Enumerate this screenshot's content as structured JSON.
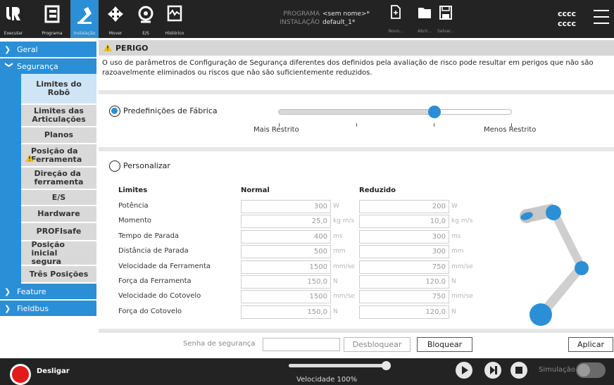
{
  "topbar": {
    "tabs": [
      {
        "label": "Executar",
        "icon": "ur-logo-icon"
      },
      {
        "label": "Programa",
        "icon": "program-icon"
      },
      {
        "label": "Instalação",
        "icon": "installation-icon"
      },
      {
        "label": "Mover",
        "icon": "move-icon"
      },
      {
        "label": "E/S",
        "icon": "io-icon"
      },
      {
        "label": "Histórico",
        "icon": "log-icon"
      }
    ],
    "programa_label": "PROGRAMA",
    "programa_value": "<sem nome>*",
    "instalacao_label": "INSTALAÇÃO",
    "instalacao_value": "default_1*",
    "file_buttons": [
      {
        "label": "Novo..."
      },
      {
        "label": "Abrir..."
      },
      {
        "label": "Salvar..."
      }
    ],
    "user_line1": "cccc",
    "user_line2": "cccc"
  },
  "sidebar": {
    "geral": "Geral",
    "seguranca": "Segurança",
    "items": [
      {
        "label": "Limites do Robô"
      },
      {
        "label": "Limites das Articulações"
      },
      {
        "label": "Planos"
      },
      {
        "label": "Posição da Ferramenta"
      },
      {
        "label": "Direção da ferramenta"
      },
      {
        "label": "E/S"
      },
      {
        "label": "Hardware"
      },
      {
        "label": "PROFIsafe"
      },
      {
        "label": "Posição inicial segura"
      },
      {
        "label": "Três Posições"
      }
    ],
    "feature": "Feature",
    "fieldbus": "Fieldbus"
  },
  "main": {
    "warning_title": "PERIGO",
    "warning_text": "O uso de parâmetros de Configuração de Segurança diferentes dos definidos pela avaliação de risco pode resultar em perigos que não são razoavelmente eliminados ou riscos que não são suficientemente reduzidos.",
    "factory_label": "Predefinições de Fábrica",
    "slider_min_label": "Mais Restrito",
    "slider_max_label": "Menos Restrito",
    "slider_level": 0.67,
    "custom_label": "Personalizar",
    "table": {
      "headers": [
        "Limites",
        "Normal",
        "Reduzido"
      ],
      "rows": [
        {
          "label": "Potência",
          "normal": "300",
          "normal_unit": "W",
          "reduced": "200",
          "reduced_unit": "W"
        },
        {
          "label": "Momento",
          "normal": "25,0",
          "normal_unit": "kg m/s",
          "reduced": "10,0",
          "reduced_unit": "kg m/s"
        },
        {
          "label": "Tempo de Parada",
          "normal": "400",
          "normal_unit": "ms",
          "reduced": "300",
          "reduced_unit": "ms"
        },
        {
          "label": "Distância de Parada",
          "normal": "500",
          "normal_unit": "mm",
          "reduced": "300",
          "reduced_unit": "mm"
        },
        {
          "label": "Velocidade da Ferramenta",
          "normal": "1500",
          "normal_unit": "mm/se",
          "reduced": "750",
          "reduced_unit": "mm/se"
        },
        {
          "label": "Força da Ferramenta",
          "normal": "150,0",
          "normal_unit": "N",
          "reduced": "120,0",
          "reduced_unit": "N"
        },
        {
          "label": "Velocidade do Cotovelo",
          "normal": "1500",
          "normal_unit": "mm/se",
          "reduced": "750",
          "reduced_unit": "mm/se"
        },
        {
          "label": "Força do Cotovelo",
          "normal": "150,0",
          "normal_unit": "N",
          "reduced": "120,0",
          "reduced_unit": "N"
        }
      ]
    },
    "password_label": "Senha de segurança",
    "unlock_button": "Desbloquear",
    "lock_button": "Bloquear",
    "apply_button": "Aplicar"
  },
  "footer": {
    "power_label": "Desligar",
    "speed_label": "Velocidade 100%",
    "speed_level": 1.0,
    "simulation_label": "Simulação"
  },
  "colors": {
    "accent": "#2a8fd6",
    "topbar_bg": "#232323",
    "power_red": "#e31b1b",
    "warning_yellow": "#f2c21b"
  }
}
